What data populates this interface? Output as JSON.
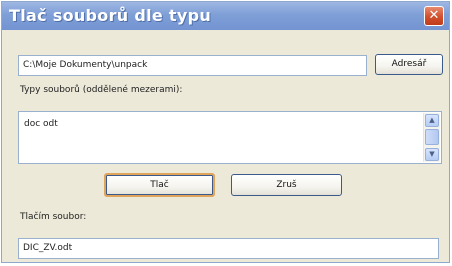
{
  "window": {
    "title": "Tlač souborů dle typu",
    "close_glyph": "✕"
  },
  "path_field": {
    "value": "C:\\Moje Dokumenty\\unpack"
  },
  "browse_button": {
    "label": "Adresář"
  },
  "types_label": "Typy souborů (oddělené mezerami):",
  "types_area": {
    "value": "doc odt"
  },
  "buttons": {
    "print": "Tlač",
    "cancel": "Zruš"
  },
  "printing_label": "Tlačím soubor:",
  "file_field": {
    "value": "DIC_ZV.odt"
  },
  "icons": {
    "close": "close-icon",
    "scroll_up": "scroll-up-icon",
    "scroll_down": "scroll-down-icon"
  },
  "colors": {
    "title_bar": "#7f9fd7",
    "close_button": "#d14f2b",
    "dialog_bg": "#ece9d8",
    "focus_ring": "#e0a45a"
  }
}
